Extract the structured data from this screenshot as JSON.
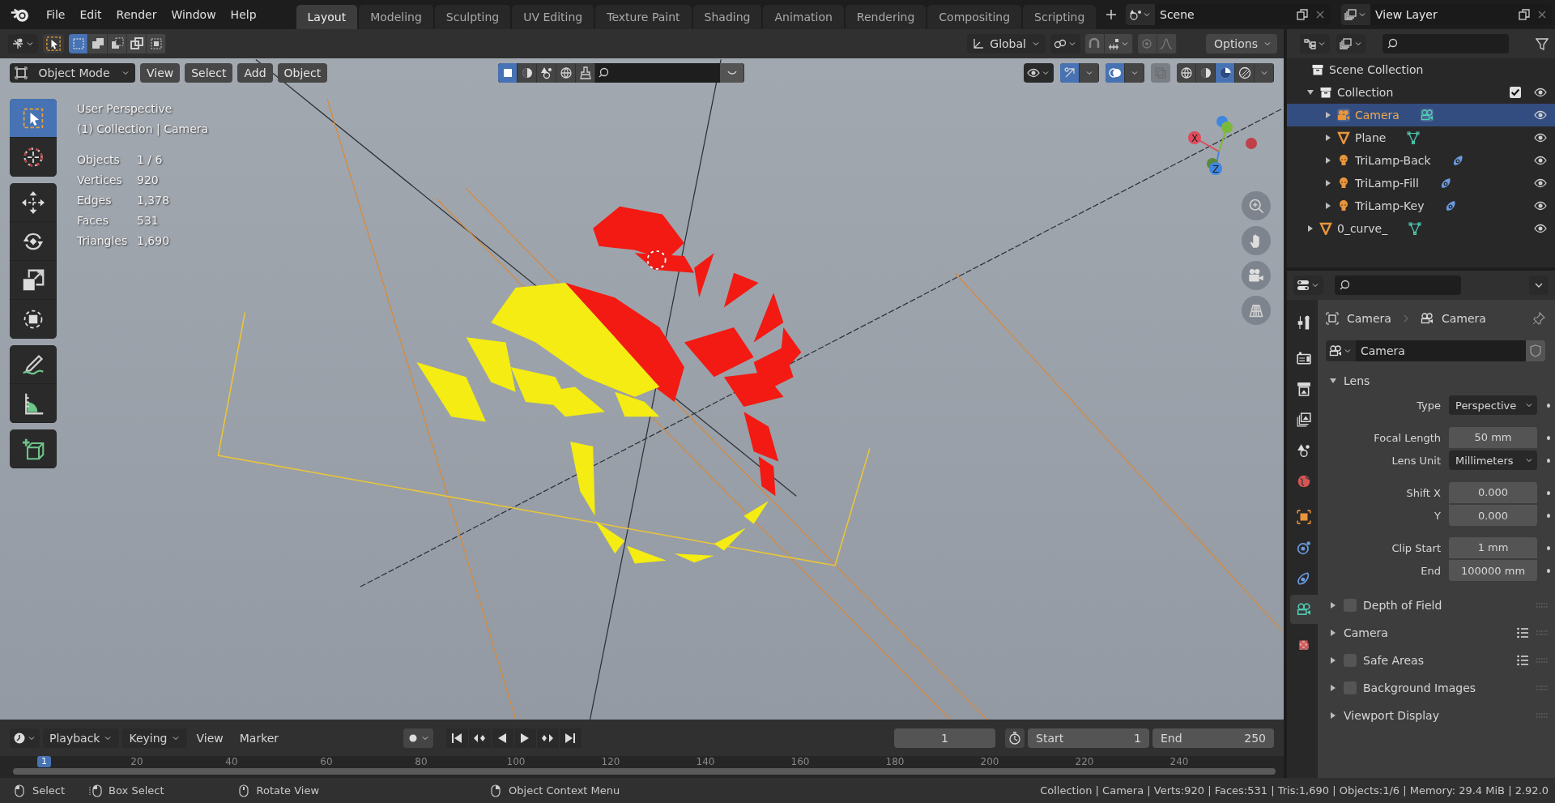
{
  "menu": [
    "File",
    "Edit",
    "Render",
    "Window",
    "Help"
  ],
  "workspaces": [
    {
      "label": "Layout",
      "selected": true
    },
    {
      "label": "Modeling",
      "selected": false
    },
    {
      "label": "Sculpting",
      "selected": false
    },
    {
      "label": "UV Editing",
      "selected": false
    },
    {
      "label": "Texture Paint",
      "selected": false
    },
    {
      "label": "Shading",
      "selected": false
    },
    {
      "label": "Animation",
      "selected": false
    },
    {
      "label": "Rendering",
      "selected": false
    },
    {
      "label": "Compositing",
      "selected": false
    },
    {
      "label": "Scripting",
      "selected": false
    }
  ],
  "scene": "Scene",
  "view_layer": "View Layer",
  "tool_header": {
    "select_modes": [
      {
        "kind": "new",
        "selected": true
      },
      {
        "kind": "extend",
        "selected": false
      },
      {
        "kind": "subtract",
        "selected": false
      },
      {
        "kind": "invert",
        "selected": false
      },
      {
        "kind": "intersect",
        "selected": false
      }
    ],
    "orientation": "Global",
    "options": "Options"
  },
  "viewport_header": {
    "mode": "Object Mode",
    "menus": [
      "View",
      "Select",
      "Add",
      "Object"
    ],
    "filters": [
      {
        "kind": "object",
        "selected": true
      },
      {
        "kind": "solid",
        "selected": false
      },
      {
        "kind": "scene",
        "selected": false
      },
      {
        "kind": "world",
        "selected": false
      },
      {
        "kind": "brush",
        "selected": false
      }
    ],
    "shading": [
      {
        "kind": "wireframe",
        "selected": false
      },
      {
        "kind": "solid",
        "selected": false
      },
      {
        "kind": "material",
        "selected": true
      },
      {
        "kind": "rendered",
        "selected": false
      }
    ]
  },
  "tools": [
    [
      {
        "kind": "select",
        "selected": true
      },
      {
        "kind": "cursor",
        "selected": false
      }
    ],
    [
      {
        "kind": "move",
        "selected": false
      },
      {
        "kind": "rotate",
        "selected": false
      },
      {
        "kind": "scale",
        "selected": false
      },
      {
        "kind": "transform",
        "selected": false
      }
    ],
    [
      {
        "kind": "annotate",
        "selected": false
      },
      {
        "kind": "measure",
        "selected": false
      }
    ],
    [
      {
        "kind": "add-cube",
        "selected": false
      }
    ]
  ],
  "viewport": {
    "view_name": "User Perspective",
    "context": "(1) Collection | Camera",
    "stats": [
      {
        "label": "Objects",
        "value": "1 / 6"
      },
      {
        "label": "Vertices",
        "value": "920"
      },
      {
        "label": "Edges",
        "value": "1,378"
      },
      {
        "label": "Faces",
        "value": "531"
      },
      {
        "label": "Triangles",
        "value": "1,690"
      }
    ],
    "gizmo_axes": [
      "X",
      "Z"
    ]
  },
  "outliner": {
    "root": "Scene Collection",
    "items": [
      {
        "name": "Collection",
        "kind": "collection",
        "expanded": true,
        "checked": true,
        "selected": false,
        "children": [
          {
            "name": "Camera",
            "kind": "camera",
            "selected": true,
            "expanded": false
          },
          {
            "name": "Plane",
            "kind": "mesh",
            "selected": false,
            "expanded": false
          },
          {
            "name": "TriLamp-Back",
            "kind": "light",
            "selected": false,
            "expanded": false
          },
          {
            "name": "TriLamp-Fill",
            "kind": "light",
            "selected": false,
            "expanded": false
          },
          {
            "name": "TriLamp-Key",
            "kind": "light",
            "selected": false,
            "expanded": false
          }
        ]
      },
      {
        "name": "0_curve_",
        "kind": "mesh",
        "selected": false,
        "expanded": false
      }
    ]
  },
  "properties": {
    "tabs": [
      {
        "kind": "tool",
        "selected": false
      },
      {
        "kind": "render",
        "selected": false
      },
      {
        "kind": "output",
        "selected": false
      },
      {
        "kind": "view-layer",
        "selected": false
      },
      {
        "kind": "scene",
        "selected": false
      },
      {
        "kind": "world",
        "selected": false
      },
      {
        "kind": "object",
        "selected": false
      },
      {
        "kind": "physics",
        "selected": false
      },
      {
        "kind": "constraints",
        "selected": false
      },
      {
        "kind": "camera-data",
        "selected": true
      },
      {
        "kind": "texture",
        "selected": false
      }
    ],
    "breadcrumb": [
      "Camera",
      "Camera"
    ],
    "data_name": "Camera",
    "lens": {
      "title": "Lens",
      "expanded": true,
      "groups": [
        [
          {
            "label": "Type",
            "value": "Perspective",
            "kind": "dropdown"
          }
        ],
        [
          {
            "label": "Focal Length",
            "value": "50 mm",
            "kind": "number"
          },
          {
            "label": "Lens Unit",
            "value": "Millimeters",
            "kind": "dropdown"
          }
        ],
        [
          {
            "label": "Shift X",
            "value": "0.000",
            "kind": "number"
          },
          {
            "label": "Y",
            "value": "0.000",
            "kind": "number"
          }
        ],
        [
          {
            "label": "Clip Start",
            "value": "1 mm",
            "kind": "number"
          },
          {
            "label": "End",
            "value": "100000 mm",
            "kind": "number"
          }
        ]
      ]
    },
    "panels": [
      {
        "title": "Depth of Field",
        "kind": "checkbox",
        "checked": false,
        "presets": false
      },
      {
        "title": "Camera",
        "kind": "plain",
        "presets": true
      },
      {
        "title": "Safe Areas",
        "kind": "checkbox",
        "checked": false,
        "presets": true
      },
      {
        "title": "Background Images",
        "kind": "checkbox",
        "checked": false,
        "presets": false
      },
      {
        "title": "Viewport Display",
        "kind": "plain",
        "presets": false
      }
    ]
  },
  "timeline": {
    "menus": [
      "Playback",
      "Keying",
      "View",
      "Marker"
    ],
    "current_frame": "1",
    "start_label": "Start",
    "start": "1",
    "end_label": "End",
    "end": "250",
    "playhead": "1",
    "ruler": [
      "20",
      "40",
      "60",
      "80",
      "100",
      "120",
      "140",
      "160",
      "180",
      "200",
      "220",
      "240"
    ]
  },
  "status_bar": {
    "hints": [
      {
        "kind": "left",
        "label": "Select"
      },
      {
        "kind": "drag",
        "label": "Box Select"
      },
      {
        "kind": "middle",
        "label": "Rotate View"
      },
      {
        "kind": "right",
        "label": "Object Context Menu"
      }
    ],
    "info": "Collection | Camera | Verts:920 | Faces:531 | Tris:1,690 | Objects:1/6 | Memory: 29.4 MiB | 2.92.0"
  }
}
